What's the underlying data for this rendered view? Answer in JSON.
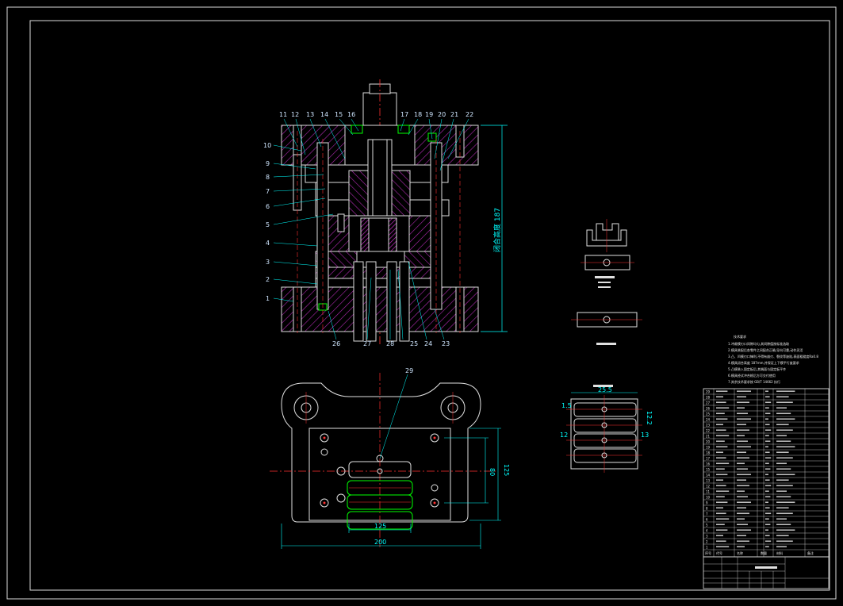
{
  "drawing": {
    "part_labels_top": [
      "11",
      "12",
      "13",
      "14",
      "15",
      "16",
      "17",
      "18",
      "19",
      "20",
      "21",
      "22"
    ],
    "part_labels_left": [
      "10",
      "9",
      "8",
      "7",
      "6",
      "5",
      "4",
      "3",
      "2",
      "1"
    ],
    "part_labels_bottom": [
      "26",
      "27",
      "28",
      "25",
      "24",
      "23"
    ],
    "part_label_plan": "29",
    "dims": {
      "closed_height": "闭合高度 187",
      "width_outer": "200",
      "width_inner": "125",
      "height_plan_outer": "125",
      "height_plan_inner": "80",
      "strip_width": "25.5",
      "strip_left": "1.5",
      "strip_left_b": "12",
      "strip_right": "13",
      "strip_right_a": "12.2"
    },
    "tech_notes_title": "技术要求",
    "tech_notes": [
      "1.冲裁模刃口间隙均匀,其间隙值按标准选取",
      "2.模具装配后各零件之间配合正确,导向可靠,动作灵活",
      "3.凸、凹模刃口锋利,不得有崩刃、裂纹等缺陷,表面粗糙度Ra0.8",
      "4.模具闭合高度 187mm,并保证上下模平行度要求",
      "5.凸模装入固定板后,其端面与固定板平齐",
      "6.模具经试冲合格后方可交付使用",
      "7.其余技术要求按 GB/T 14662 执行"
    ],
    "bom_rows": [
      "29",
      "28",
      "27",
      "26",
      "25",
      "24",
      "23",
      "22",
      "21",
      "20",
      "19",
      "18",
      "17",
      "16",
      "15",
      "14",
      "13",
      "12",
      "11",
      "10",
      "9",
      "8",
      "7",
      "6",
      "5",
      "4",
      "3",
      "2",
      "1"
    ],
    "bom_header": [
      "序号",
      "代号",
      "名称",
      "数量",
      "材料",
      "备注"
    ]
  }
}
